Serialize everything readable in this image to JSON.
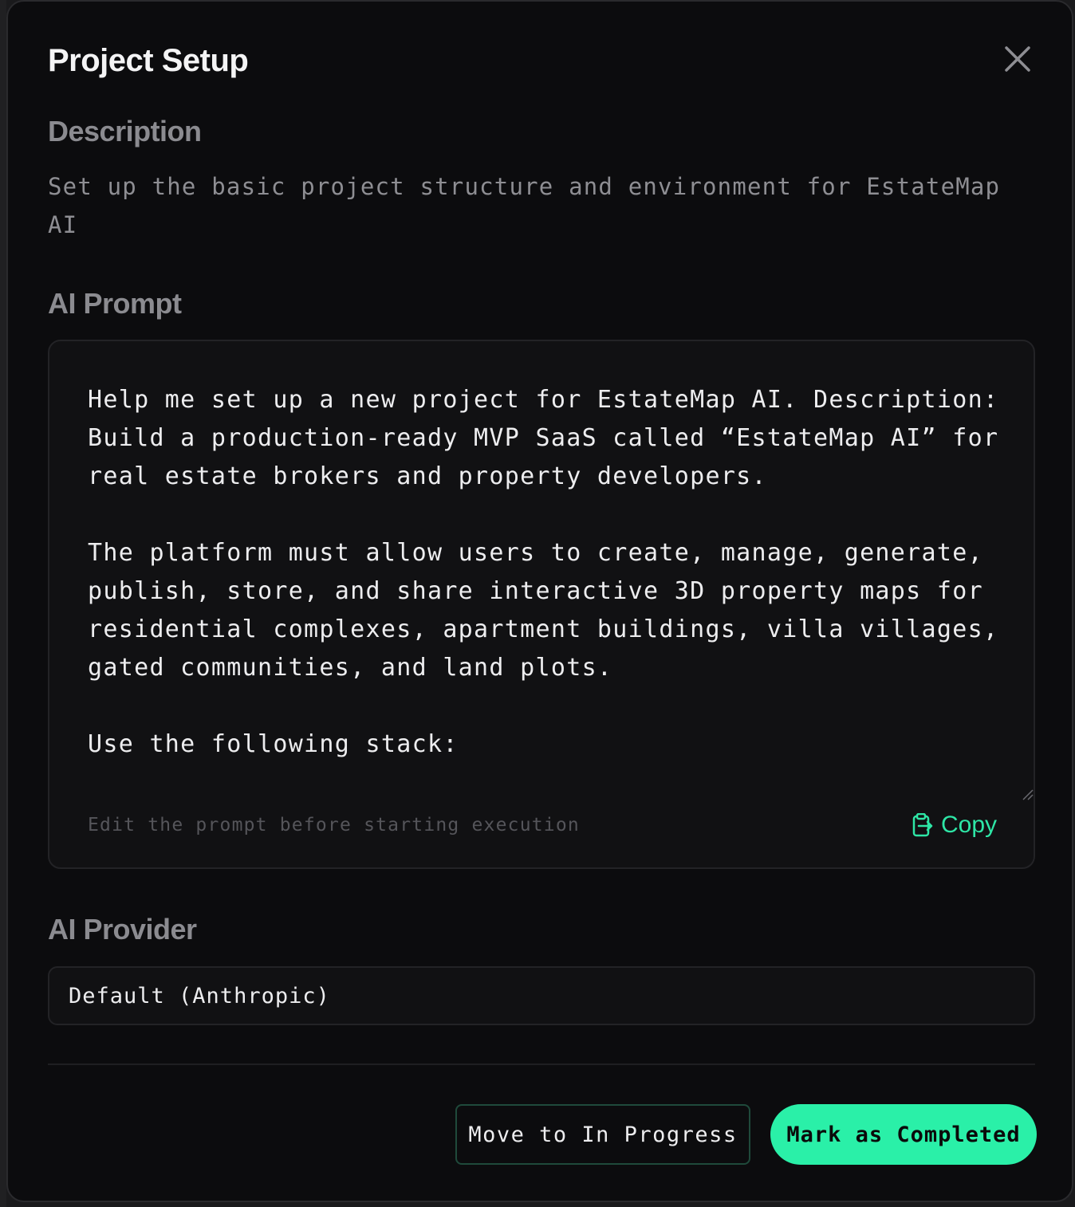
{
  "modal": {
    "title": "Project Setup",
    "close_icon": "close-icon"
  },
  "description": {
    "heading": "Description",
    "text": "Set up the basic project structure and environment for EstateMap AI"
  },
  "ai_prompt": {
    "heading": "AI Prompt",
    "text": "Help me set up a new project for EstateMap AI. Description: Build a production-ready MVP SaaS called “EstateMap AI” for real estate brokers and property developers.\n\nThe platform must allow users to create, manage, generate, publish, store, and share interactive 3D property maps for residential complexes, apartment buildings, villa villages, gated communities, and land plots.\n\nUse the following stack:",
    "hint": "Edit the prompt before starting execution",
    "copy_label": "Copy",
    "copy_icon": "clipboard-copy-icon"
  },
  "ai_provider": {
    "heading": "AI Provider",
    "selected": "Default (Anthropic)"
  },
  "actions": {
    "move_label": "Move to In Progress",
    "complete_label": "Mark as Completed"
  },
  "colors": {
    "accent": "#2af0a8",
    "background": "#0c0c0e",
    "panel": "#111113",
    "border": "#232326",
    "heading_muted": "#8b8b90",
    "text": "#ededef"
  }
}
